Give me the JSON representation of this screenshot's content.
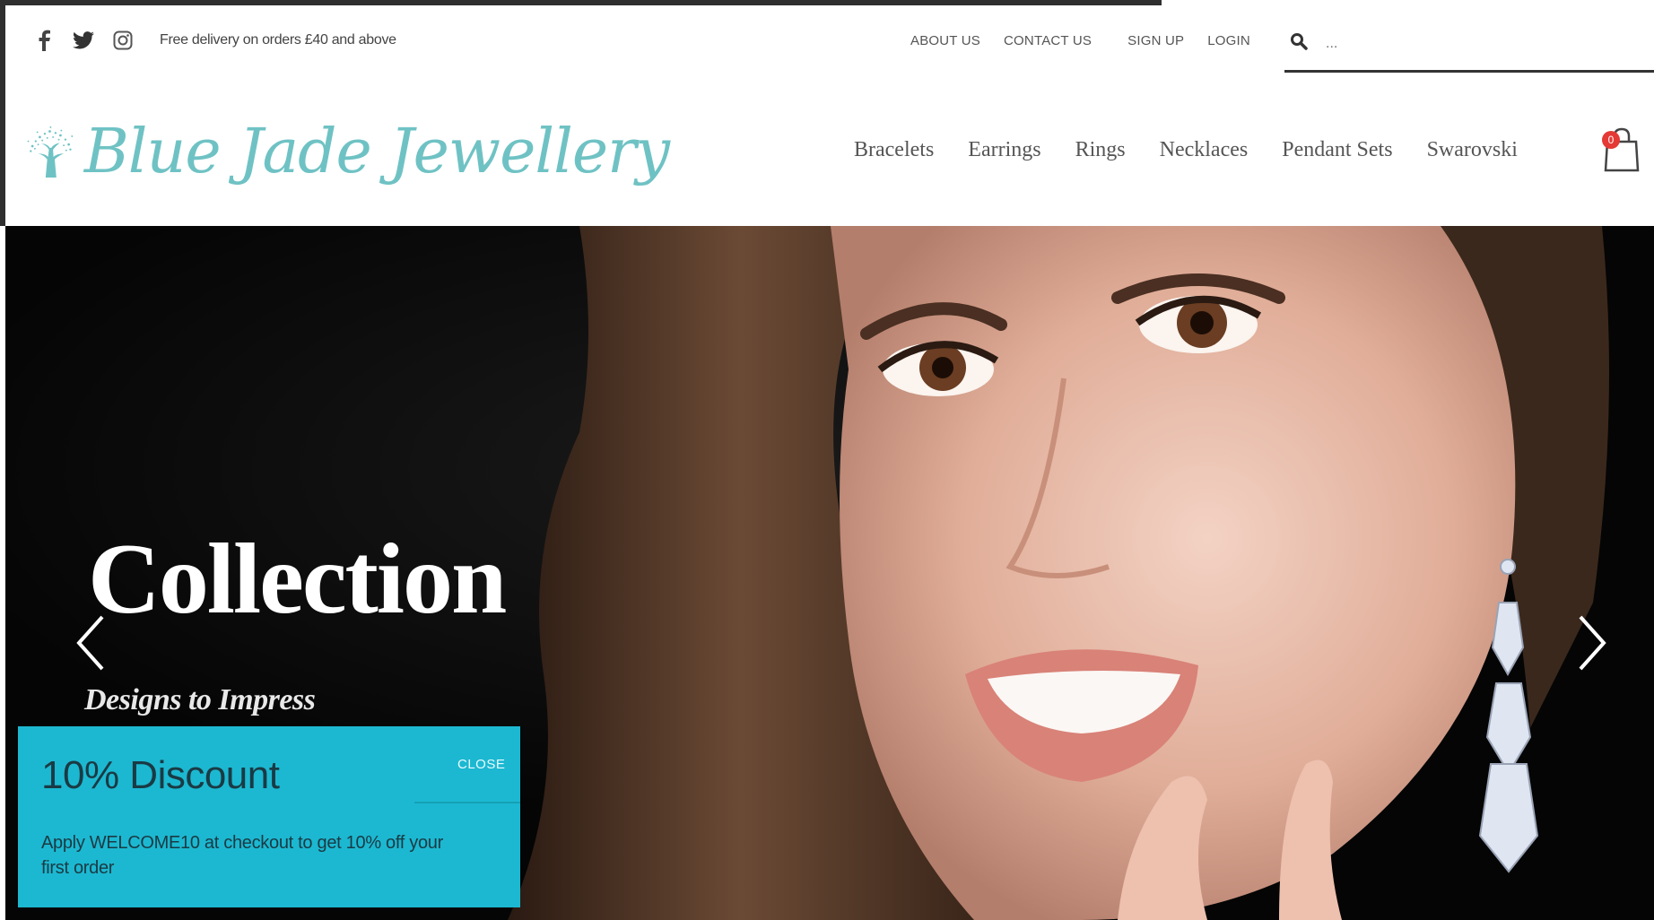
{
  "topbar": {
    "social": [
      {
        "name": "facebook-icon"
      },
      {
        "name": "twitter-icon"
      },
      {
        "name": "instagram-icon"
      }
    ],
    "promo_text": "Free delivery on orders £40 and above",
    "links": [
      "ABOUT US",
      "CONTACT US",
      "SIGN UP",
      "LOGIN"
    ],
    "search": {
      "placeholder": "...",
      "icon": "search-icon"
    }
  },
  "header": {
    "brand": "Blue Jade Jewellery",
    "brand_color": "#6fc2c4",
    "nav": [
      "Bracelets",
      "Earrings",
      "Rings",
      "Necklaces",
      "Pendant Sets",
      "Swarovski"
    ],
    "cart": {
      "icon": "shopping-bag-icon",
      "count": "0",
      "badge_color": "#e53935"
    }
  },
  "hero": {
    "title": "Collection",
    "subtitle": "Designs to Impress",
    "prev_icon": "chevron-left-icon",
    "next_icon": "chevron-right-icon"
  },
  "discount_popup": {
    "title": "10% Discount",
    "close_label": "CLOSE",
    "text": "Apply WELCOME10 at checkout to get 10% off your first order",
    "background": "#1cb8d1"
  }
}
